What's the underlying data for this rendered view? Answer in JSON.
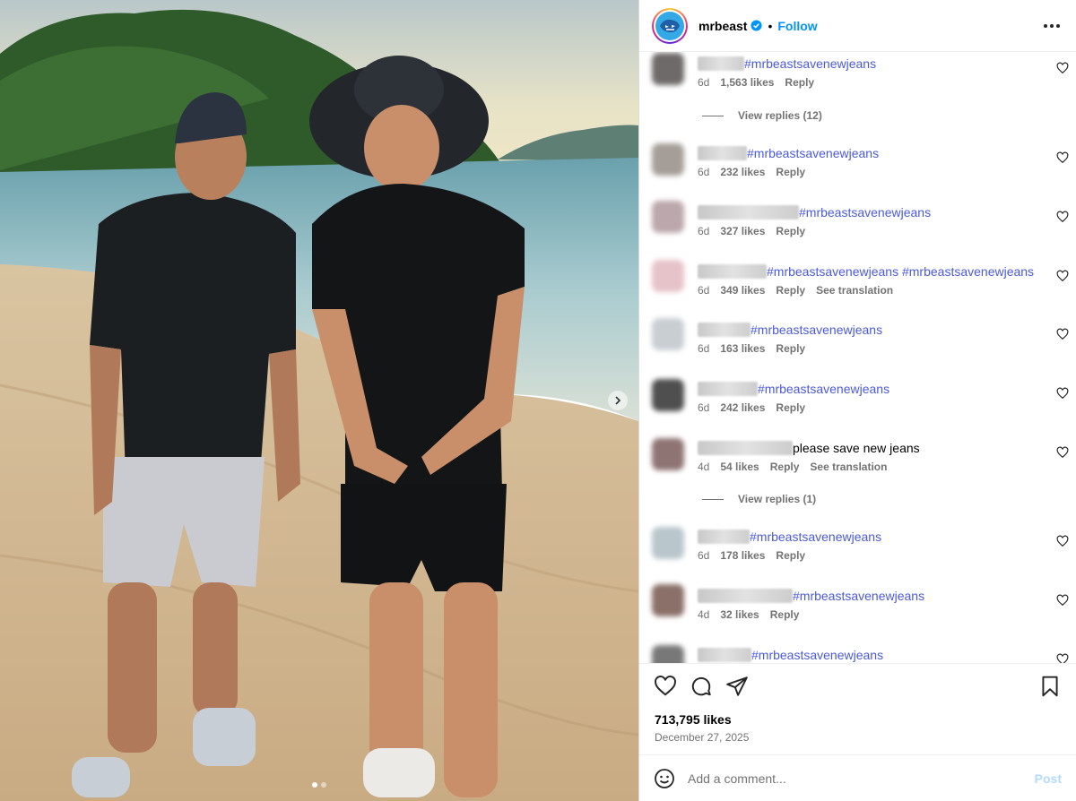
{
  "post": {
    "username": "mrbeast",
    "separator": "•",
    "follow_label": "Follow",
    "likes": "713,795 likes",
    "date": "December 27, 2025"
  },
  "comments": [
    {
      "text": "#mrbeastsavenewjeans",
      "age": "6d",
      "likes": "1,563 likes",
      "reply": "Reply",
      "translation": "",
      "replies": "View replies (12)"
    },
    {
      "text": "#mrbeastsavenewjeans",
      "age": "6d",
      "likes": "232 likes",
      "reply": "Reply",
      "translation": "",
      "replies": ""
    },
    {
      "text": "#mrbeastsavenewjeans",
      "age": "6d",
      "likes": "327 likes",
      "reply": "Reply",
      "translation": "",
      "replies": ""
    },
    {
      "text": "#mrbeastsavenewjeans #mrbeastsavenewjeans",
      "age": "6d",
      "likes": "349 likes",
      "reply": "Reply",
      "translation": "See translation",
      "replies": ""
    },
    {
      "text": "#mrbeastsavenewjeans",
      "age": "6d",
      "likes": "163 likes",
      "reply": "Reply",
      "translation": "",
      "replies": ""
    },
    {
      "text": "#mrbeastsavenewjeans",
      "age": "6d",
      "likes": "242 likes",
      "reply": "Reply",
      "translation": "",
      "replies": ""
    },
    {
      "text": "please save new jeans",
      "age": "4d",
      "likes": "54 likes",
      "reply": "Reply",
      "translation": "See translation",
      "replies": "View replies (1)"
    },
    {
      "text": "#mrbeastsavenewjeans",
      "age": "6d",
      "likes": "178 likes",
      "reply": "Reply",
      "translation": "",
      "replies": ""
    },
    {
      "text": "#mrbeastsavenewjeans",
      "age": "4d",
      "likes": "32 likes",
      "reply": "Reply",
      "translation": "",
      "replies": ""
    },
    {
      "text": "#mrbeastsavenewjeans",
      "age": "",
      "likes": "",
      "reply": "",
      "translation": "",
      "replies": ""
    }
  ],
  "composer": {
    "placeholder": "Add a comment...",
    "post_label": "Post"
  },
  "icons": {
    "header": [
      "verified-badge-icon",
      "more-options-icon"
    ],
    "actions": [
      "heart-icon",
      "comment-icon",
      "share-icon",
      "bookmark-icon"
    ],
    "composer": [
      "emoji-icon"
    ],
    "photo": [
      "next-arrow-icon"
    ]
  },
  "colors": {
    "link": "#0095f6",
    "hashtag": "#4a5ad8",
    "muted": "#737373",
    "post_disabled": "#b3dbff"
  }
}
